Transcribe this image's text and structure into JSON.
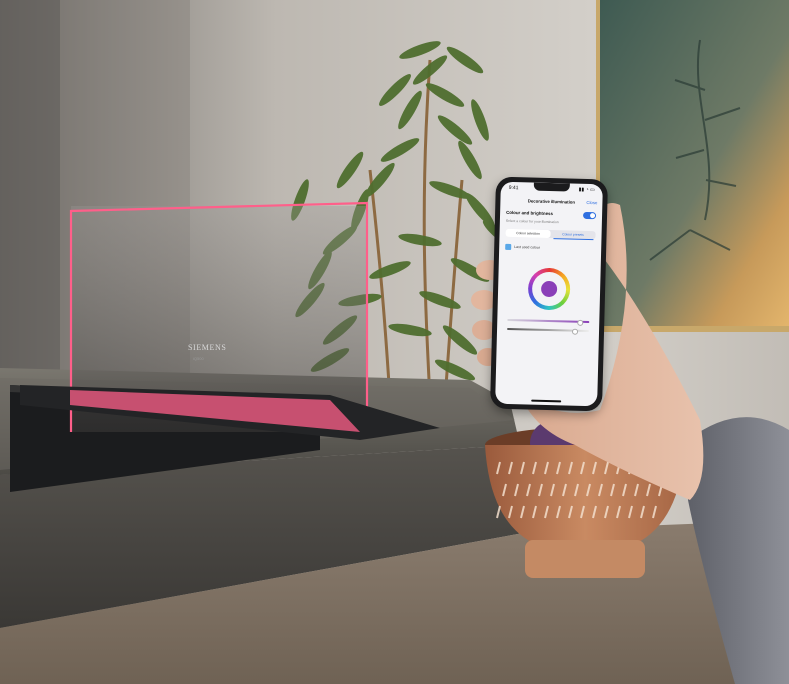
{
  "brand": {
    "logo_text": "SIEMENS",
    "logo_sub": "iQ500"
  },
  "phone_app": {
    "status_time": "9:41",
    "status_icons": "▮▮ ◔ ▭",
    "title": "Decorative illumination",
    "close_label": "Close",
    "section_title": "Colour and brightness",
    "section_subtitle": "Select a colour for your illumination",
    "toggle_on": true,
    "tabs": [
      "Colour selection",
      "Colour presets"
    ],
    "checkbox_label": "Last used colour",
    "selected_colour": "#8a3fb8",
    "saturation_level": 0.88,
    "brightness_level": 0.82
  },
  "colors": {
    "light_strip": "#ff5f8a",
    "wall": "#c9c4bd",
    "countertop": "#55524d"
  }
}
